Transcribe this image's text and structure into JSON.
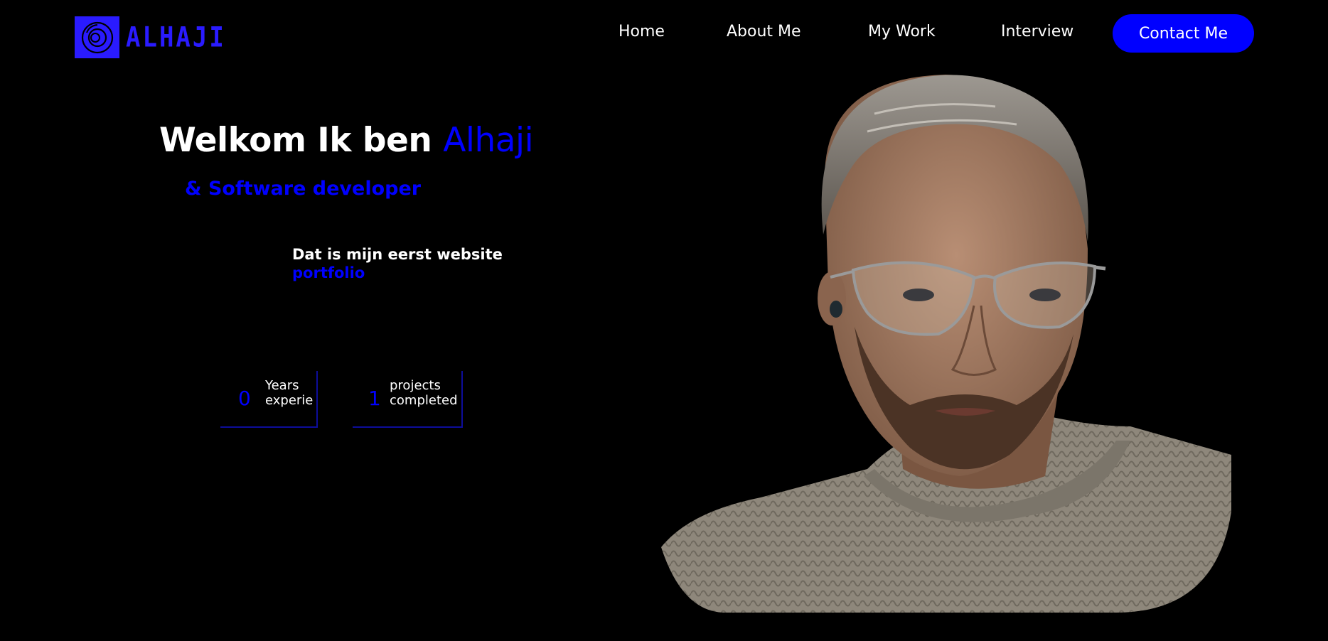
{
  "brand": {
    "name": "ALHAJI",
    "accent_color": "#0000ff",
    "logo_color": "#2a1bff"
  },
  "nav": {
    "items": [
      {
        "label": "Home"
      },
      {
        "label": "About Me"
      },
      {
        "label": "My Work"
      },
      {
        "label": "Interview"
      }
    ],
    "cta_label": "Contact Me"
  },
  "hero": {
    "greeting": "Welkom Ik ben",
    "name": "Alhaji",
    "subtitle": "& Software developer",
    "intro_line": "Dat is mijn eerst website",
    "intro_accent": "portfolio"
  },
  "stats": [
    {
      "number": "0",
      "label_line1": "Years",
      "label_line2": "experie"
    },
    {
      "number": "1",
      "label_line1": "projects",
      "label_line2": "completed"
    }
  ],
  "portrait": {
    "icon": "person-portrait-icon"
  }
}
